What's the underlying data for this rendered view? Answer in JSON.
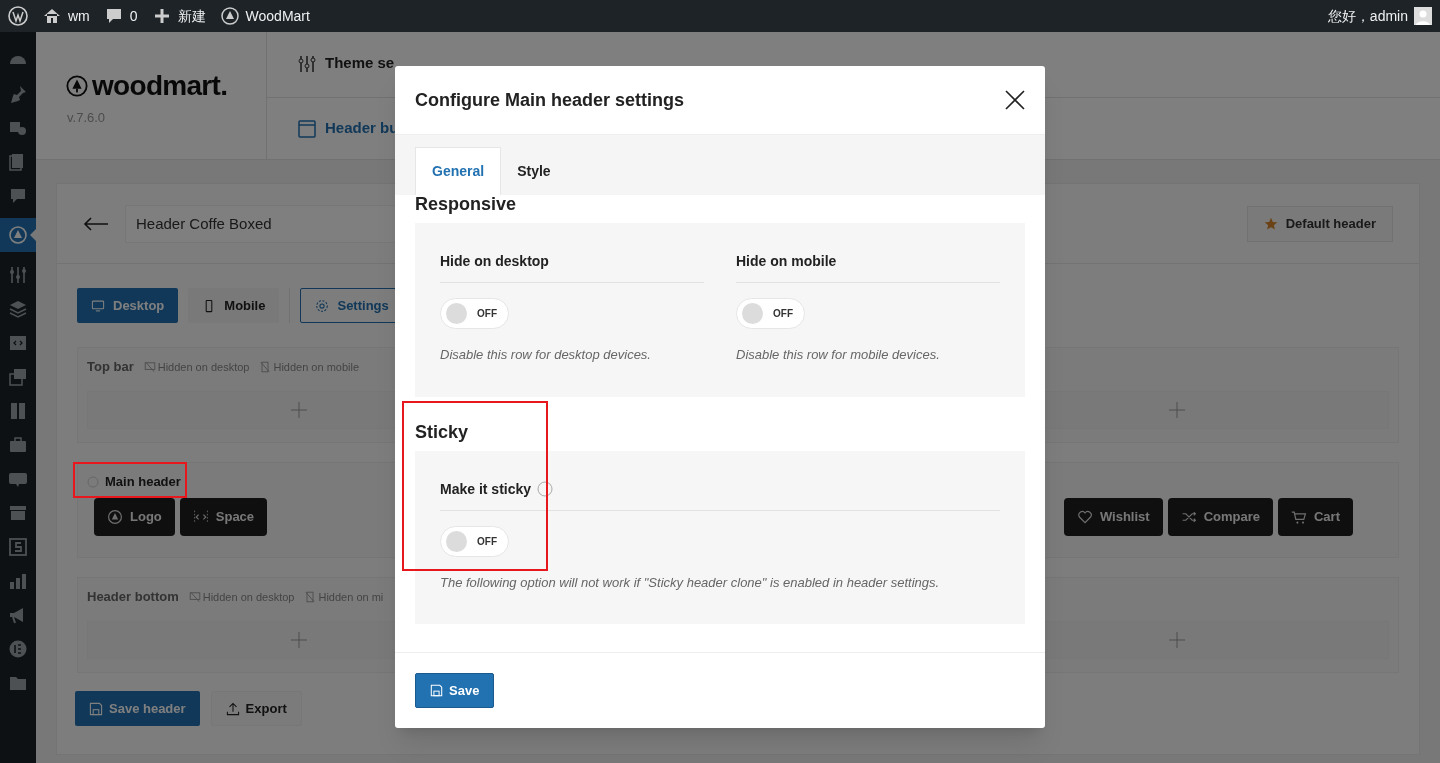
{
  "admin_bar": {
    "items": [
      {
        "kind": "wp-logo"
      },
      {
        "kind": "home",
        "label": "wm"
      },
      {
        "kind": "comments",
        "label": "0"
      },
      {
        "kind": "plus",
        "label": "新建"
      },
      {
        "kind": "brand",
        "label": "WoodMart"
      }
    ],
    "greeting": "您好，admin"
  },
  "sidebar": {
    "items": [
      {
        "kind": "gauge",
        "selected": false
      },
      {
        "kind": "pin",
        "selected": false
      },
      {
        "kind": "media",
        "selected": false
      },
      {
        "kind": "pages",
        "selected": false
      },
      {
        "kind": "comment",
        "selected": false
      },
      {
        "kind": "brand",
        "selected": true
      },
      {
        "kind": "sliders",
        "selected": false
      },
      {
        "kind": "layers",
        "selected": false
      },
      {
        "kind": "code",
        "selected": false
      },
      {
        "kind": "stack",
        "selected": false
      },
      {
        "kind": "book",
        "selected": false
      },
      {
        "kind": "briefcase",
        "selected": false
      },
      {
        "kind": "woo",
        "selected": false
      },
      {
        "kind": "archive",
        "selected": false
      },
      {
        "kind": "dollar",
        "selected": false
      },
      {
        "kind": "chart",
        "selected": false
      },
      {
        "kind": "megaphone",
        "selected": false
      },
      {
        "kind": "elementor",
        "selected": false
      },
      {
        "kind": "folder",
        "selected": false
      }
    ]
  },
  "brand": {
    "name": "woodmart.",
    "version": "v.7.6.0"
  },
  "nav": {
    "items": [
      {
        "label": "Theme se"
      }
    ],
    "subnav": {
      "label": "Header bu",
      "selected": true
    }
  },
  "builder": {
    "header_name": "Header Coffe Boxed",
    "default_button": "Default header",
    "devices": [
      {
        "label": "Desktop",
        "selected": true
      },
      {
        "label": "Mobile",
        "selected": false
      }
    ],
    "settings_button": "Settings",
    "rows": [
      {
        "title": "Top bar",
        "highlighted": false,
        "tags": [
          "Hidden on desktop",
          "Hidden on mobile"
        ]
      },
      {
        "title": "Main header",
        "highlighted": true,
        "elements_left": [
          {
            "kind": "logo",
            "label": "Logo"
          },
          {
            "kind": "space",
            "label": "Space"
          }
        ],
        "elements_right": [
          {
            "kind": "wishlist",
            "label": "Wishlist"
          },
          {
            "kind": "compare",
            "label": "Compare"
          },
          {
            "kind": "cart",
            "label": "Cart"
          }
        ]
      },
      {
        "title": "Header bottom",
        "highlighted": false,
        "tags": [
          "Hidden on desktop",
          "Hidden on mi"
        ]
      }
    ],
    "actions": [
      {
        "kind": "primary",
        "label": "Save header"
      },
      {
        "kind": "secondary",
        "label": "Export"
      }
    ]
  },
  "modal": {
    "title": "Configure Main header settings",
    "tabs": [
      {
        "label": "General",
        "selected": true
      },
      {
        "label": "Style",
        "selected": false
      }
    ],
    "sections": [
      {
        "title": "Responsive",
        "highlighted": false,
        "fields": [
          {
            "label": "Hide on desktop",
            "info": false,
            "on": false,
            "state_label": "OFF",
            "description": "Disable this row for desktop devices."
          },
          {
            "label": "Hide on mobile",
            "info": false,
            "on": false,
            "state_label": "OFF",
            "description": "Disable this row for mobile devices."
          }
        ]
      },
      {
        "title": "Sticky",
        "highlighted": true,
        "fields": [
          {
            "label": "Make it sticky",
            "info": true,
            "on": false,
            "state_label": "OFF",
            "description": "The following option will not work if \"Sticky header clone\" is enabled in header settings."
          }
        ]
      }
    ],
    "save_button": "Save"
  }
}
